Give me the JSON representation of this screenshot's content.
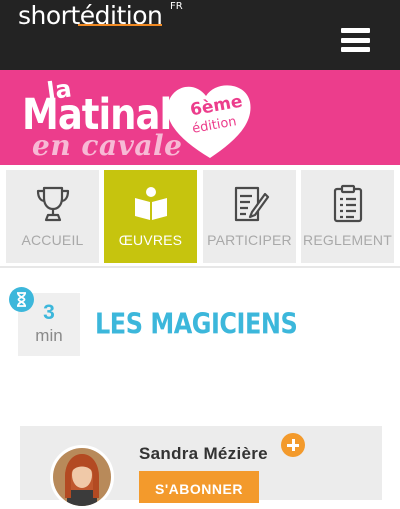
{
  "header": {
    "logo_text": "shortédition",
    "logo_sup": "FR",
    "menu_icon": "hamburger-menu-icon"
  },
  "banner": {
    "line1": "la",
    "line2": "Matinale",
    "line3": "en cavale",
    "heart_line1": "6ème",
    "heart_line2": "édition"
  },
  "nav": {
    "items": [
      {
        "label": "ACCUEIL",
        "icon": "trophy-icon"
      },
      {
        "label": "ŒUVRES",
        "icon": "open-book-icon",
        "active": true
      },
      {
        "label": "PARTICIPER",
        "icon": "writing-icon"
      },
      {
        "label": "REGLEMENT",
        "icon": "clipboard-list-icon"
      }
    ]
  },
  "article": {
    "read_time_value": "3",
    "read_time_unit": "min",
    "title": "LES MAGICIENS"
  },
  "author": {
    "name": "Sandra Mézière",
    "subscribe_label": "S'ABONNER"
  },
  "colors": {
    "header_bg": "#232323",
    "banner_pink": "#ec3d8c",
    "active_tile": "#c6c40e",
    "accent_blue": "#3cb7db",
    "accent_orange": "#f39a2c"
  }
}
